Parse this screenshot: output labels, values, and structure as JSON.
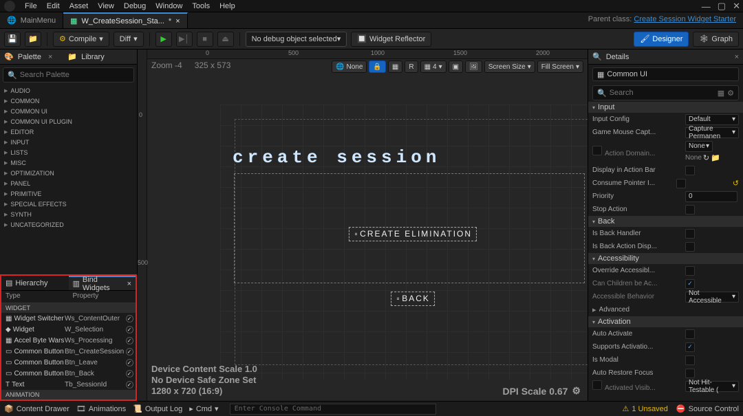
{
  "menu": {
    "items": [
      "File",
      "Edit",
      "Asset",
      "View",
      "Debug",
      "Window",
      "Tools",
      "Help"
    ]
  },
  "tabs": {
    "main": "MainMenu",
    "active": "W_CreateSession_Sta...",
    "dirty": "*",
    "parent_prefix": "Parent class:",
    "parent_class": "Create Session Widget Starter"
  },
  "toolbar": {
    "compile": "Compile",
    "diff": "Diff",
    "debug_object": "No debug object selected",
    "widget_reflector": "Widget Reflector",
    "designer": "Designer",
    "graph": "Graph"
  },
  "palette": {
    "title": "Palette",
    "library": "Library",
    "search_ph": "Search Palette",
    "cats": [
      "AUDIO",
      "COMMON",
      "COMMON UI",
      "COMMON UI PLUGIN",
      "EDITOR",
      "INPUT",
      "LISTS",
      "MISC",
      "OPTIMIZATION",
      "PANEL",
      "PRIMITIVE",
      "SPECIAL EFFECTS",
      "SYNTH",
      "UNCATEGORIZED"
    ]
  },
  "hier": {
    "tab1": "Hierarchy",
    "tab2": "Bind Widgets",
    "col_type": "Type",
    "col_prop": "Property",
    "sec_widget": "WIDGET",
    "sec_anim": "ANIMATION",
    "rows": [
      {
        "type": "Widget Switcher",
        "prop": "Ws_ContentOuter"
      },
      {
        "type": "Widget",
        "prop": "W_Selection"
      },
      {
        "type": "Accel Byte Wars",
        "prop": "Ws_Processing"
      },
      {
        "type": "Common Button",
        "prop": "Btn_CreateSession"
      },
      {
        "type": "Common Button",
        "prop": "Btn_Leave"
      },
      {
        "type": "Common Button",
        "prop": "Btn_Back"
      },
      {
        "type": "Text",
        "prop": "Tb_SessionId"
      }
    ]
  },
  "viewport": {
    "zoom": "Zoom -4",
    "dims": "325 x 573",
    "localize": "None",
    "snap_n": "4",
    "screensize": "Screen Size",
    "fill": "Fill Screen",
    "ruler": [
      "0",
      "500",
      "1000",
      "1500",
      "2000"
    ],
    "rulerV": [
      "0",
      "500"
    ],
    "title_text": "create session",
    "btn_create": "CREATE ELIMINATION",
    "btn_back": "BACK",
    "footer1": "Device Content Scale 1.0",
    "footer2": "No Device Safe Zone Set",
    "footer3": "1280 x 720 (16:9)",
    "dpi": "DPI Scale 0.67"
  },
  "details": {
    "title": "Details",
    "name": "Common UI",
    "search_ph": "Search",
    "sec_input": "Input",
    "input_config_lbl": "Input Config",
    "input_config": "Default",
    "mouse_lbl": "Game Mouse Capt...",
    "mouse": "Capture Permanen",
    "action_domain_lbl": "Action Domain...",
    "action_domain_none": "None",
    "action_domain_sel": "None",
    "display_action_lbl": "Display in Action Bar",
    "consume_lbl": "Consume Pointer I...",
    "priority_lbl": "Priority",
    "priority": "0",
    "stop_lbl": "Stop Action",
    "sec_back": "Back",
    "back_handler_lbl": "Is Back Handler",
    "back_disp_lbl": "Is Back Action Disp...",
    "sec_acc": "Accessibility",
    "override_lbl": "Override Accessibl...",
    "children_lbl": "Can Children be Ac...",
    "behavior_lbl": "Accessible Behavior",
    "behavior": "Not Accessible",
    "advanced": "Advanced",
    "sec_activ": "Activation",
    "auto_act_lbl": "Auto Activate",
    "supports_lbl": "Supports Activatio...",
    "modal_lbl": "Is Modal",
    "restore_lbl": "Auto Restore Focus",
    "actvis_lbl": "Activated Visib...",
    "actvis": "Not Hit-Testable ("
  },
  "status": {
    "drawer": "Content Drawer",
    "anim": "Animations",
    "log": "Output Log",
    "cmd": "Cmd",
    "cmd_ph": "Enter Console Command",
    "unsaved": "1 Unsaved",
    "source": "Source Control"
  }
}
